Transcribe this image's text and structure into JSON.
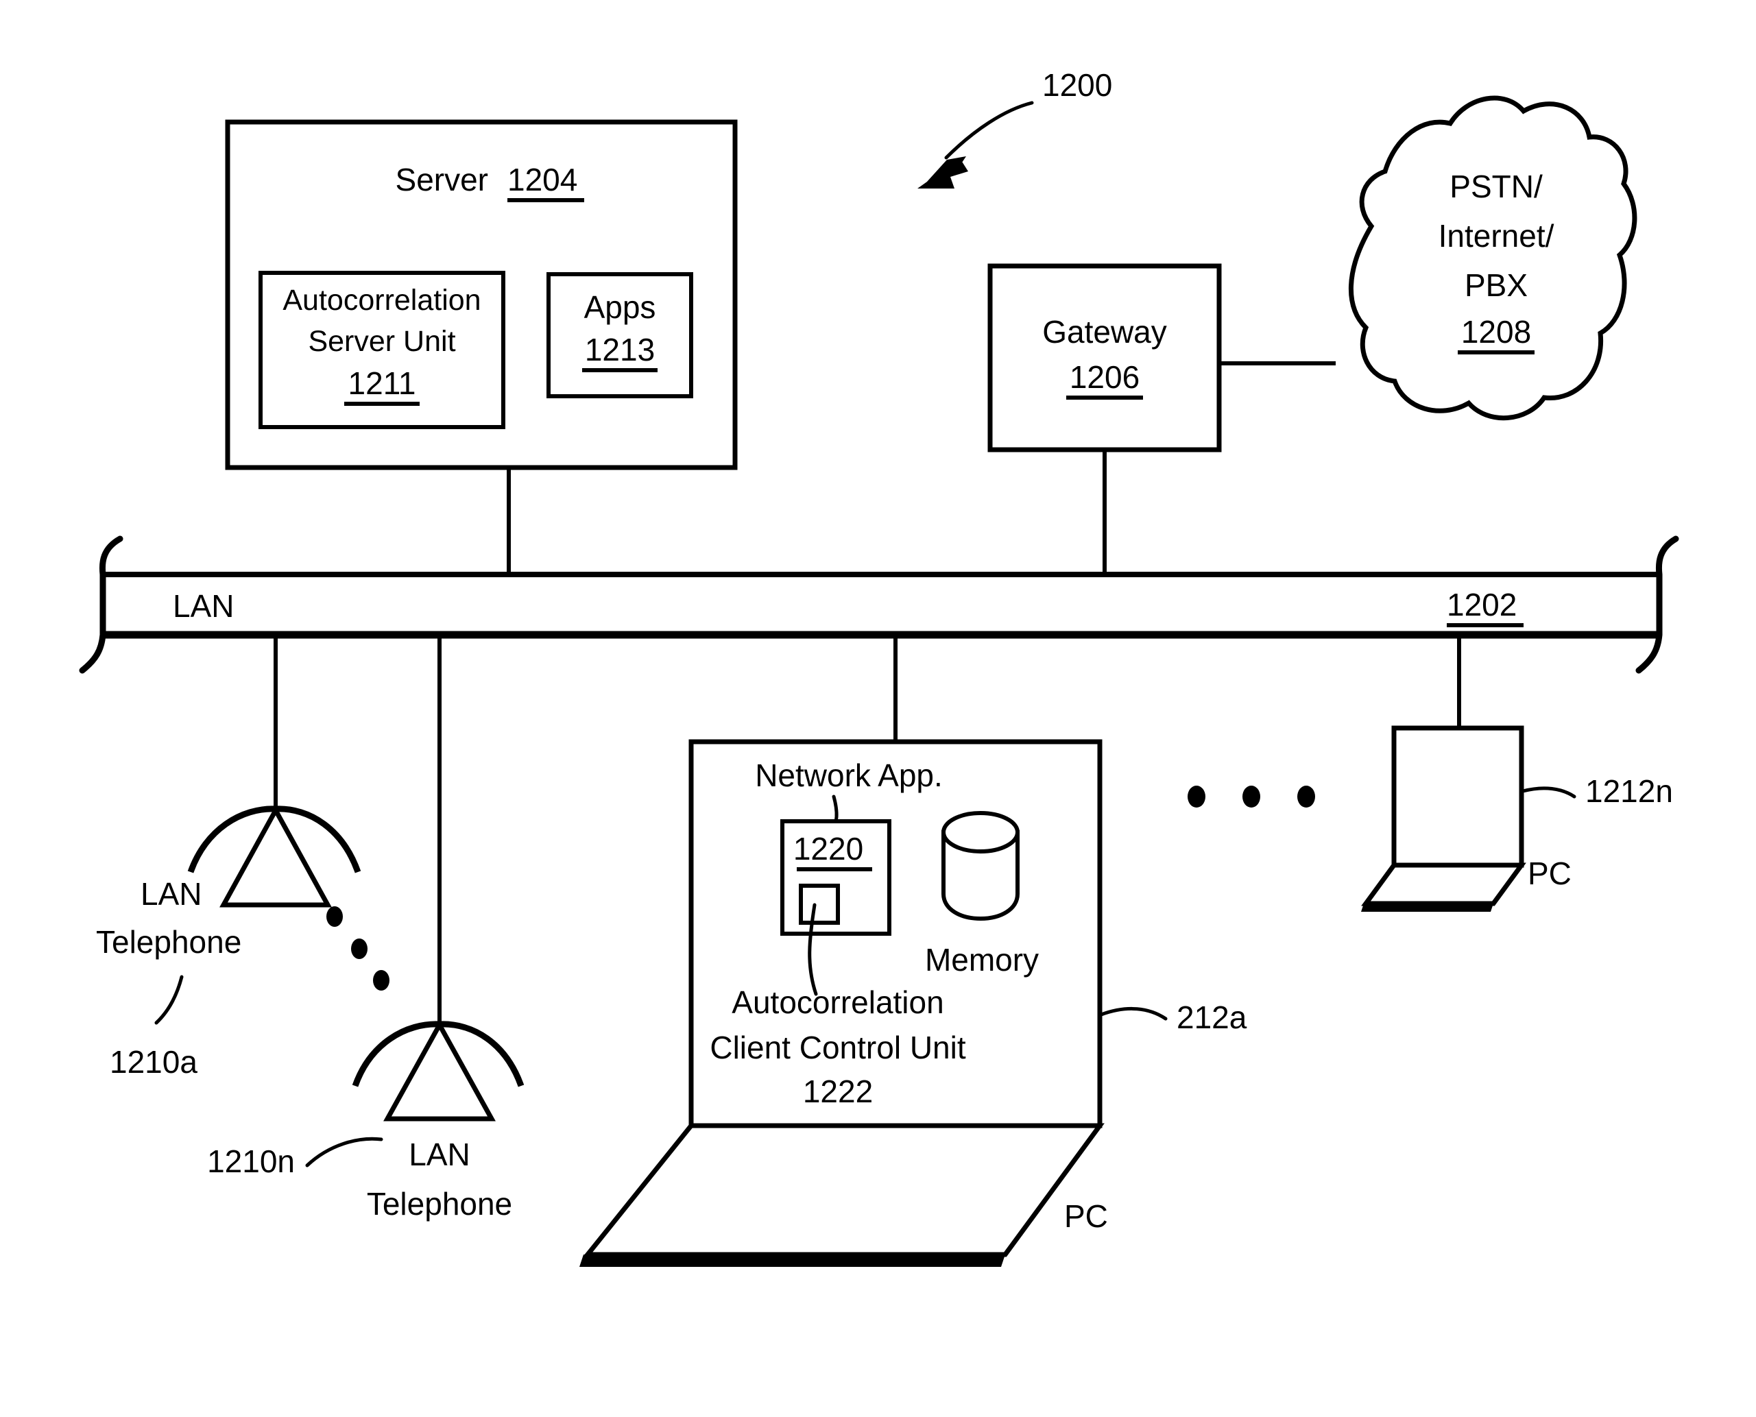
{
  "figure": {
    "number": "1200",
    "title_note": "Network system block diagram"
  },
  "server": {
    "label": "Server",
    "ref": "1204",
    "units": [
      {
        "name": "autocorrelation-server-unit",
        "line1": "Autocorrelation",
        "line2": "Server Unit",
        "ref": "1211"
      },
      {
        "name": "apps",
        "line1": "Apps",
        "ref": "1213"
      }
    ]
  },
  "gateway": {
    "label": "Gateway",
    "ref": "1206"
  },
  "cloud": {
    "line1": "PSTN/",
    "line2": "Internet/",
    "line3": "PBX",
    "ref": "1208"
  },
  "lan": {
    "label": "LAN",
    "ref": "1202"
  },
  "telephones": [
    {
      "line1": "LAN",
      "line2": "Telephone",
      "ref": "1210a"
    },
    {
      "line1": "LAN",
      "line2": "Telephone",
      "ref": "1210n"
    }
  ],
  "ellipsis_between_phones": "• • •",
  "client_pc": {
    "network_app_label": "Network App.",
    "network_app_ref": "1220",
    "memory_label": "Memory",
    "control_unit_line1": "Autocorrelation",
    "control_unit_line2": "Client Control Unit",
    "control_unit_ref": "1222",
    "device_ref": "212a",
    "device_label": "PC"
  },
  "ellipsis_between_pcs": "• • •",
  "remote_pc": {
    "ref": "1212n",
    "label": "PC"
  }
}
